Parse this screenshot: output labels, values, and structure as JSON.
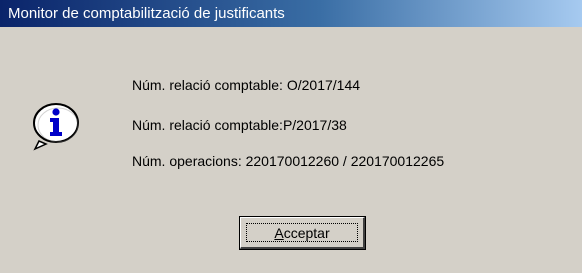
{
  "window": {
    "title": "Monitor de comptabilització de justificants"
  },
  "dialog": {
    "icon": "information-icon",
    "messages": [
      "Núm. relació comptable: O/2017/144",
      "Núm. relació comptable:P/2017/38",
      "Núm. operacions: 220170012260 / 220170012265"
    ],
    "ok_button": {
      "mnemonic": "A",
      "rest": "cceptar"
    }
  },
  "colors": {
    "dialog_background": "#d4d0c8",
    "titlebar_start": "#0a246a",
    "titlebar_end": "#a6caf0",
    "title_text": "#ffffff"
  }
}
